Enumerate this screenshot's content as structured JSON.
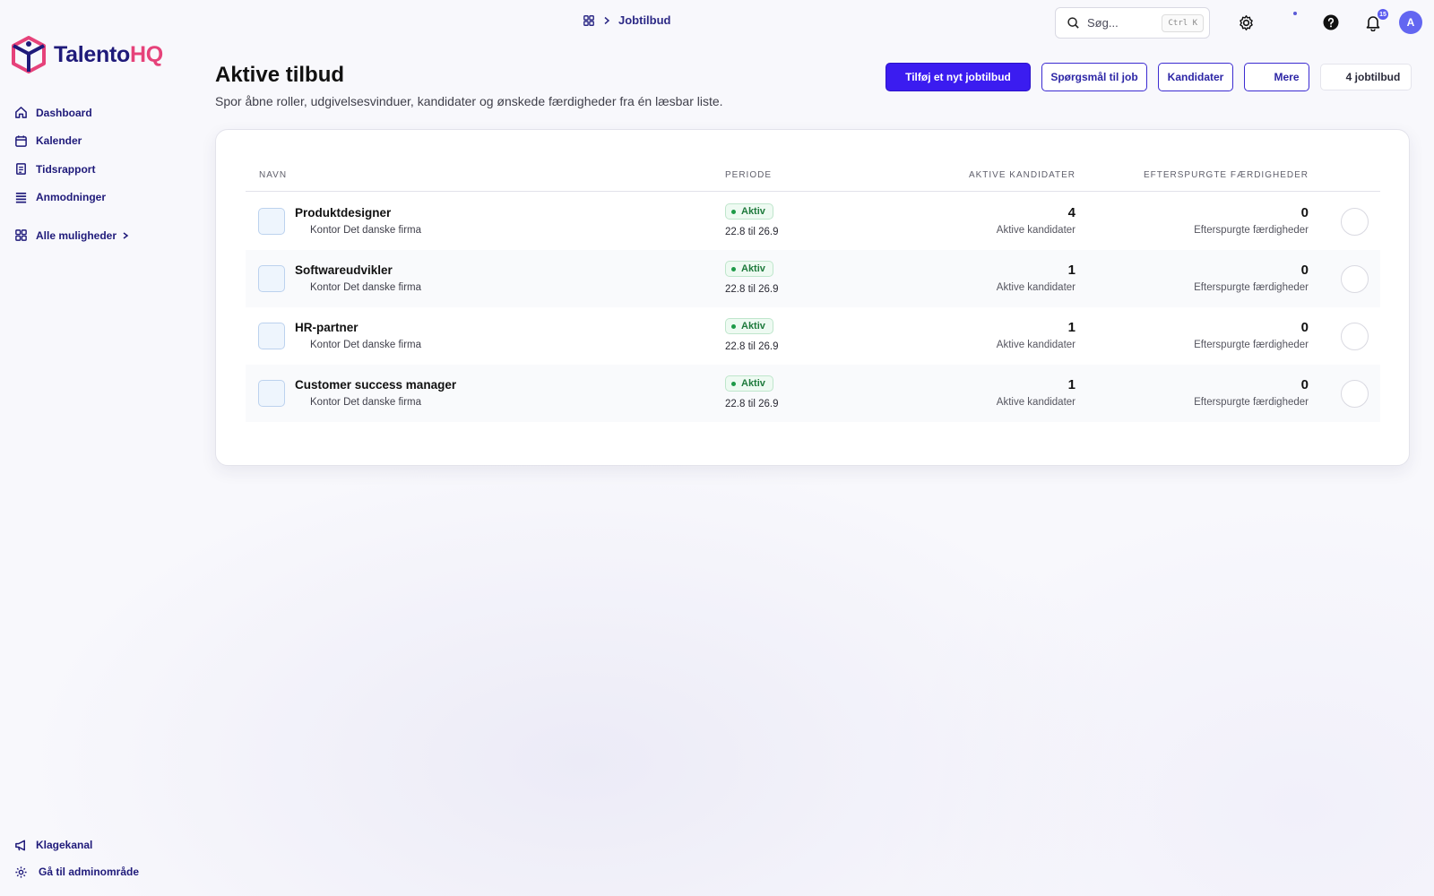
{
  "brand": {
    "name_part1": "Talento",
    "name_part2": "HQ",
    "color_primary": "#1f1a7a",
    "color_accent": "#e6427a"
  },
  "sidebar": {
    "items": [
      {
        "label": "Dashboard",
        "icon": "home-icon"
      },
      {
        "label": "Kalender",
        "icon": "calendar-icon"
      },
      {
        "label": "Tidsrapport",
        "icon": "timesheet-icon"
      },
      {
        "label": "Anmodninger",
        "icon": "list-icon"
      }
    ],
    "all_label": "Alle muligheder",
    "bottom": [
      {
        "label": "Klagekanal",
        "icon": "megaphone-icon"
      },
      {
        "label": "Gå til adminområde",
        "icon": "gear-icon"
      }
    ]
  },
  "topbar": {
    "breadcrumb": "Jobtilbud",
    "search_placeholder": "Søg...",
    "search_shortcut": "Ctrl K",
    "notifications_count": "15",
    "avatar_initial": "A"
  },
  "header": {
    "title": "Aktive tilbud",
    "subtitle": "Spor åbne roller, udgivelsesvinduer, kandidater og ønskede færdigheder fra én læsbar liste.",
    "buttons": {
      "add": "Tilføj et nyt jobtilbud",
      "questions": "Spørgsmål til job",
      "candidates": "Kandidater",
      "more": "Mere"
    },
    "count_chip": "4 jobtilbud"
  },
  "table": {
    "columns": [
      "NAVN",
      "PERIODE",
      "AKTIVE KANDIDATER",
      "EFTERSPURGTE FÆRDIGHEDER"
    ],
    "rows": [
      {
        "name": "Produktdesigner",
        "company": "Kontor Det danske firma",
        "status": "Aktiv",
        "period": "22.8 til 26.9",
        "candidates": "4",
        "candidates_label": "Aktive kandidater",
        "skills": "0",
        "skills_label": "Efterspurgte færdigheder"
      },
      {
        "name": "Softwareudvikler",
        "company": "Kontor Det danske firma",
        "status": "Aktiv",
        "period": "22.8 til 26.9",
        "candidates": "1",
        "candidates_label": "Aktive kandidater",
        "skills": "0",
        "skills_label": "Efterspurgte færdigheder"
      },
      {
        "name": "HR-partner",
        "company": "Kontor Det danske firma",
        "status": "Aktiv",
        "period": "22.8 til 26.9",
        "candidates": "1",
        "candidates_label": "Aktive kandidater",
        "skills": "0",
        "skills_label": "Efterspurgte færdigheder"
      },
      {
        "name": "Customer success manager",
        "company": "Kontor Det danske firma",
        "status": "Aktiv",
        "period": "22.8 til 26.9",
        "candidates": "1",
        "candidates_label": "Aktive kandidater",
        "skills": "0",
        "skills_label": "Efterspurgte færdigheder"
      }
    ]
  }
}
